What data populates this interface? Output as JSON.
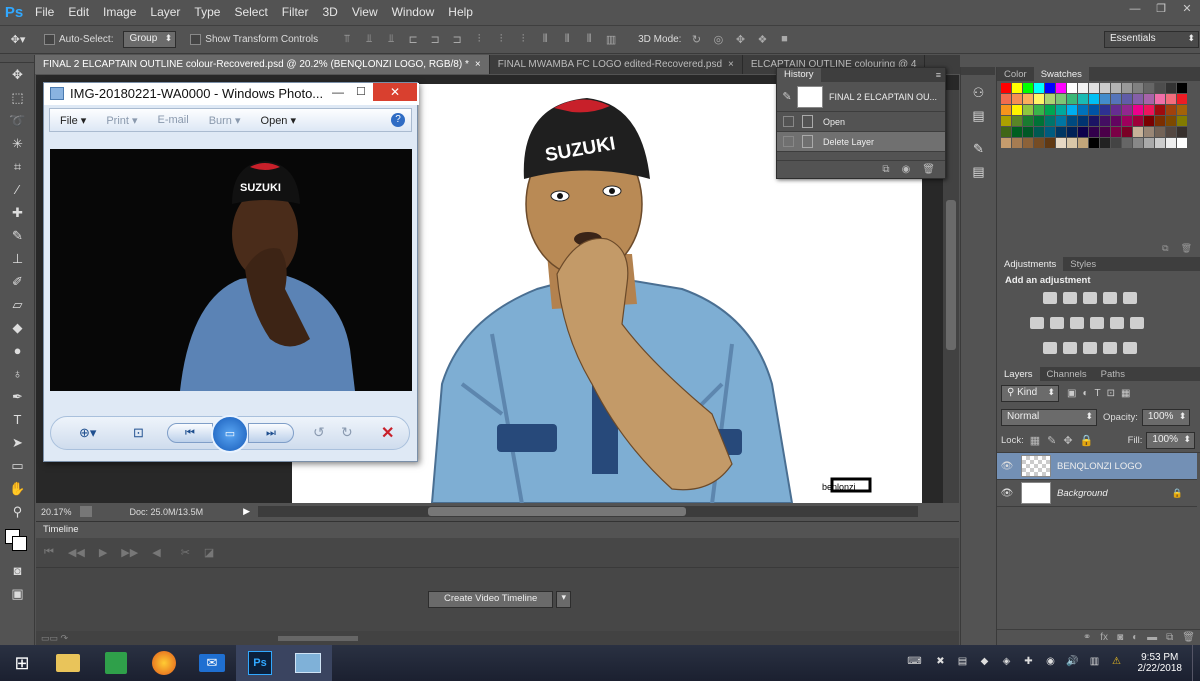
{
  "app": {
    "logo": "Ps"
  },
  "menubar": {
    "items": [
      "File",
      "Edit",
      "Image",
      "Layer",
      "Type",
      "Select",
      "Filter",
      "3D",
      "View",
      "Window",
      "Help"
    ]
  },
  "options": {
    "auto_select_label": "Auto-Select:",
    "auto_select_value": "Group",
    "show_transform": "Show Transform Controls",
    "mode_3d": "3D Mode:",
    "workspace": "Essentials"
  },
  "doc_tabs": [
    {
      "label": "FINAL 2 ELCAPTAIN OUTLINE colour-Recovered.psd @ 20.2% (BENQLONZI LOGO, RGB/8) *",
      "close": "×",
      "active": true
    },
    {
      "label": "FINAL MWAMBA FC LOGO edited-Recovered.psd",
      "close": "×",
      "active": false
    },
    {
      "label": "ELCAPTAIN OUTLINE colouring @ 4",
      "close": "",
      "active": false
    }
  ],
  "status": {
    "zoom": "20.17%",
    "doc": "Doc: 25.0M/13.5M"
  },
  "timeline": {
    "title": "Timeline",
    "create_button": "Create Video Timeline"
  },
  "photo_viewer": {
    "title": "IMG-20180221-WA0000 - Windows Photo...",
    "menu": {
      "file": "File",
      "print": "Print",
      "email": "E-mail",
      "burn": "Burn",
      "open": "Open"
    },
    "photo_cap_text": "SUZUKI"
  },
  "history": {
    "title": "History",
    "snapshot": "FINAL 2 ELCAPTAIN OU...",
    "items": [
      {
        "label": "Open"
      },
      {
        "label": "Delete Layer"
      }
    ]
  },
  "color_panel": {
    "tabs": [
      "Color",
      "Swatches"
    ]
  },
  "adjustments": {
    "tabs": [
      "Adjustments",
      "Styles"
    ],
    "heading": "Add an adjustment"
  },
  "layers": {
    "tabs": [
      "Layers",
      "Channels",
      "Paths"
    ],
    "filter_kind": "Kind",
    "blend_mode": "Normal",
    "opacity_label": "Opacity:",
    "opacity_value": "100%",
    "lock_label": "Lock:",
    "fill_label": "Fill:",
    "fill_value": "100%",
    "items": [
      {
        "name": "BENQLONZI LOGO",
        "selected": true
      },
      {
        "name": "Background",
        "selected": false
      }
    ]
  },
  "artwork": {
    "cap_text": "SUZUKI",
    "signature": "benlonzi"
  },
  "taskbar": {
    "time": "9:53 PM",
    "date": "2/22/2018"
  }
}
